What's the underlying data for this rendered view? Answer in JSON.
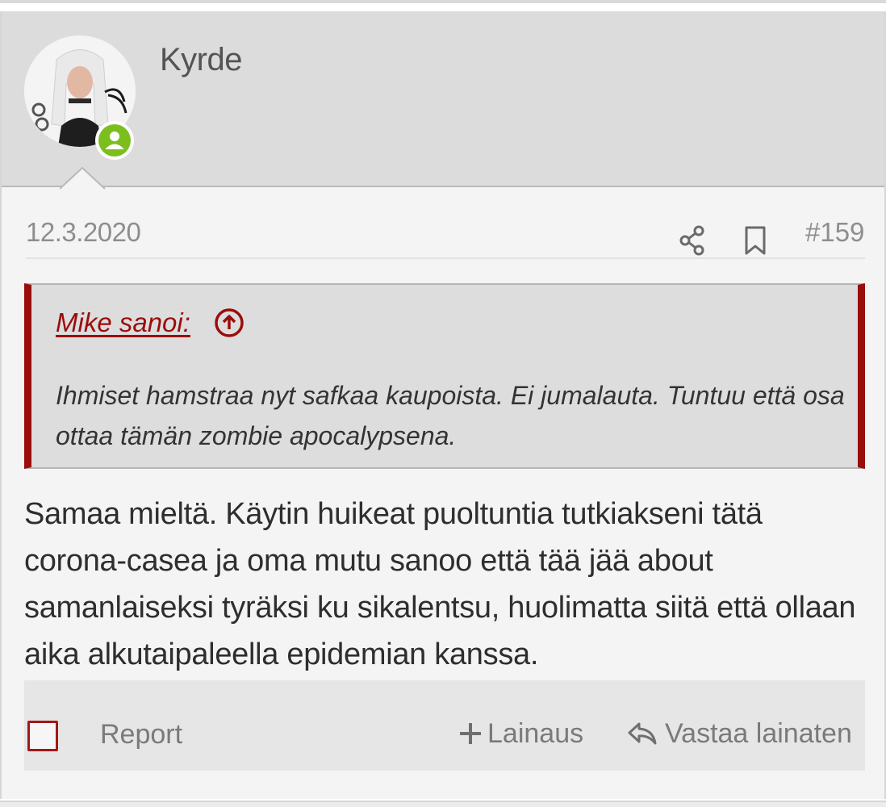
{
  "user": {
    "name": "Kyrde",
    "status": "online"
  },
  "post": {
    "date": "12.3.2020",
    "number": "#159",
    "quote": {
      "author_label": "Mike sanoi:",
      "text": "Ihmiset hamstraa nyt safkaa kaupoista. Ei jumalauta. Tuntuu että osa ottaa tämän zombie apocalypsena."
    },
    "body": "Samaa mieltä. Käytin huikeat puoltuntia tutkiakseni tätä corona-casea ja oma mutu sanoo että tää jää about samanlaiseksi tyräksi ku sikalentsu, huolimatta siitä että ollaan aika alkutaipaleella epidemian kanssa."
  },
  "actions": {
    "report_label": "Report",
    "quote_label": "Lainaus",
    "reply_label": "Vastaa lainaten"
  },
  "colors": {
    "accent": "#9a0d0d",
    "online": "#7cbf1d",
    "header_bg": "#dcdcdc",
    "muted_text": "#8e8e8e"
  },
  "icons": [
    "user-icon",
    "share-icon",
    "bookmark-icon",
    "arrow-up-circle-icon",
    "plus-icon",
    "reply-icon"
  ]
}
